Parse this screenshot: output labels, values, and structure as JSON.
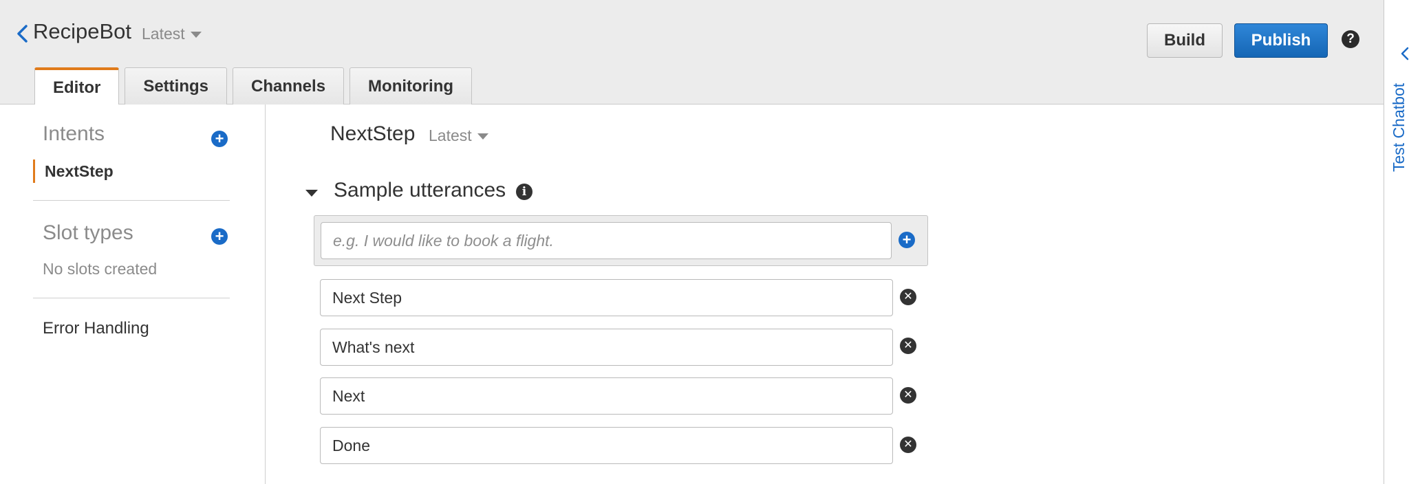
{
  "header": {
    "bot_name": "RecipeBot",
    "version": "Latest",
    "build_label": "Build",
    "publish_label": "Publish",
    "help_symbol": "?"
  },
  "tabs": [
    {
      "label": "Editor",
      "active": true
    },
    {
      "label": "Settings",
      "active": false
    },
    {
      "label": "Channels",
      "active": false
    },
    {
      "label": "Monitoring",
      "active": false
    }
  ],
  "sidebar": {
    "intents_heading": "Intents",
    "intents": [
      "NextStep"
    ],
    "slot_types_heading": "Slot types",
    "slot_types_empty": "No slots created",
    "error_handling": "Error Handling"
  },
  "intent": {
    "name": "NextStep",
    "version": "Latest"
  },
  "utterances": {
    "section_title": "Sample utterances",
    "placeholder": "e.g. I would like to book a flight.",
    "items": [
      "Next Step",
      "What's next",
      "Next",
      "Done"
    ]
  },
  "right_rail": {
    "label": "Test Chatbot"
  },
  "icons": {
    "back": "chevron-left-icon",
    "help": "question-circle-icon",
    "add": "plus-circle-icon",
    "remove": "x-circle-icon",
    "info": "info-circle-icon",
    "rail_toggle": "chevron-left-icon"
  },
  "colors": {
    "accent_orange": "#e07b1b",
    "primary_blue": "#1a6bc7",
    "header_bg": "#ececec"
  }
}
